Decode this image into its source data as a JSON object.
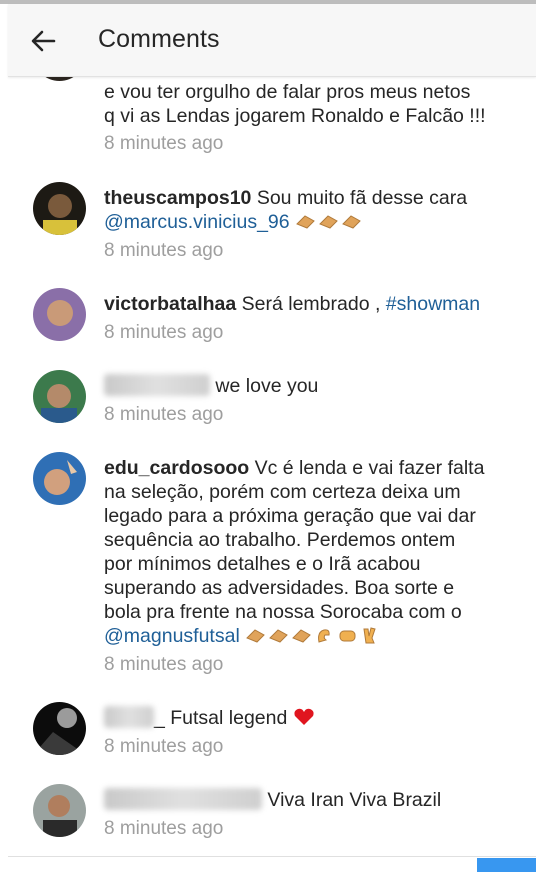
{
  "header": {
    "title": "Comments"
  },
  "comments": [
    {
      "line_a": "e vou ter orgulho de falar pros meus netos",
      "line_b": "q vi as Lendas jogarem Ronaldo e Falcão !!!",
      "time": "8 minutes ago"
    },
    {
      "user": "theuscampos10",
      "text": " Sou muito fã desse cara",
      "mention": "@marcus.vinicius_96",
      "time": "8 minutes ago"
    },
    {
      "user": "victorbatalhaa",
      "text": " Será lembrado , ",
      "tag": "#showman",
      "time": "8 minutes ago"
    },
    {
      "text": " we love you",
      "time": "8 minutes ago"
    },
    {
      "user": "edu_cardosooo",
      "text": " Vc é lenda e vai fazer falta",
      "lines": [
        "na seleção, porém com certeza deixa um",
        "legado para a próxima geração que vai dar",
        "sequência ao trabalho. Perdemos ontem",
        "por mínimos detalhes e o Irã acabou",
        "superando as adversidades. Boa sorte e",
        "bola pra frente na nossa Sorocaba com o"
      ],
      "mention": "@magnusfutsal",
      "time": "8 minutes ago"
    },
    {
      "text": "_ Futsal legend ",
      "time": "8 minutes ago"
    },
    {
      "text": " Viva Iran Viva Brazil",
      "time": "8 minutes ago"
    }
  ],
  "colors": {
    "link": "#1f5f97",
    "time": "#9e9e9e",
    "accent": "#3897f0"
  }
}
